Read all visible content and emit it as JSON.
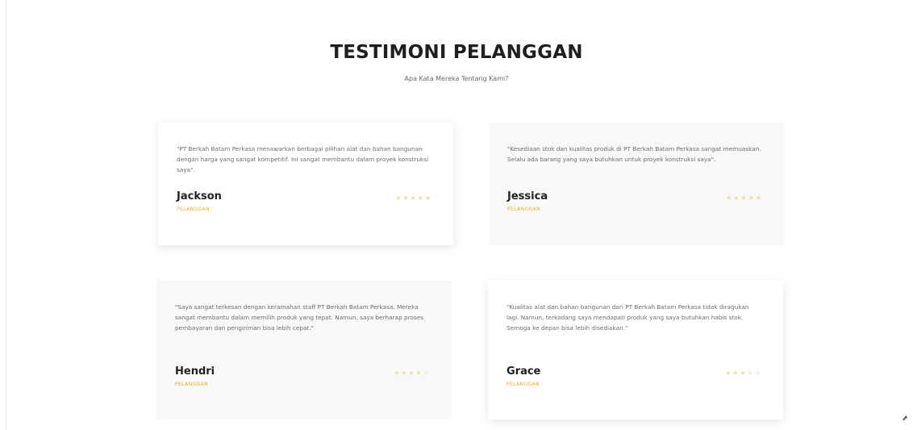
{
  "section": {
    "title": "TESTIMONI PELANGGAN",
    "subtitle": "Apa Kata Mereka Tentang Kami?"
  },
  "testimonials": [
    {
      "quote": "\"PT Berkah Batam Perkasa menawarkan berbagai pilihan alat dan bahan bangunan dengan harga yang sangat kompetitif. Ini sangat membantu dalam proyek konstruksi saya\".",
      "name": "Jackson",
      "role": "PELANGGAN",
      "rating": 5
    },
    {
      "quote": "\"Kesediaan stok dan kualitas produk di PT Berkah Batam Perkasa sangat memuaskan. Selalu ada barang yang saya butuhkan untuk proyek konstruksi saya\".",
      "name": "Jessica",
      "role": "PELANGGAN",
      "rating": 5
    },
    {
      "quote": "\"Saya sangat terkesan dengan keramahan staff PT Berkah Batam Perkasa. Mereka sangat membantu dalam memilih produk yang tepat. Namun, saya berharap proses pembayaran dan pengiriman bisa lebih cepat.\"",
      "name": "Hendri",
      "role": "PELANGGAN",
      "rating": 4
    },
    {
      "quote": "\"Kualitas alat dan bahan bangunan dari PT Berkah Batam Perkasa tidak diragukan lagi. Namun, terkadang saya mendapati produk yang saya butuhkan habis stok. Semoga ke depan bisa lebih disediakan.\"",
      "name": "Grace",
      "role": "PELANGGAN",
      "rating": 3
    }
  ],
  "star_glyph": "★",
  "icons": {
    "resize": "resize-icon"
  }
}
